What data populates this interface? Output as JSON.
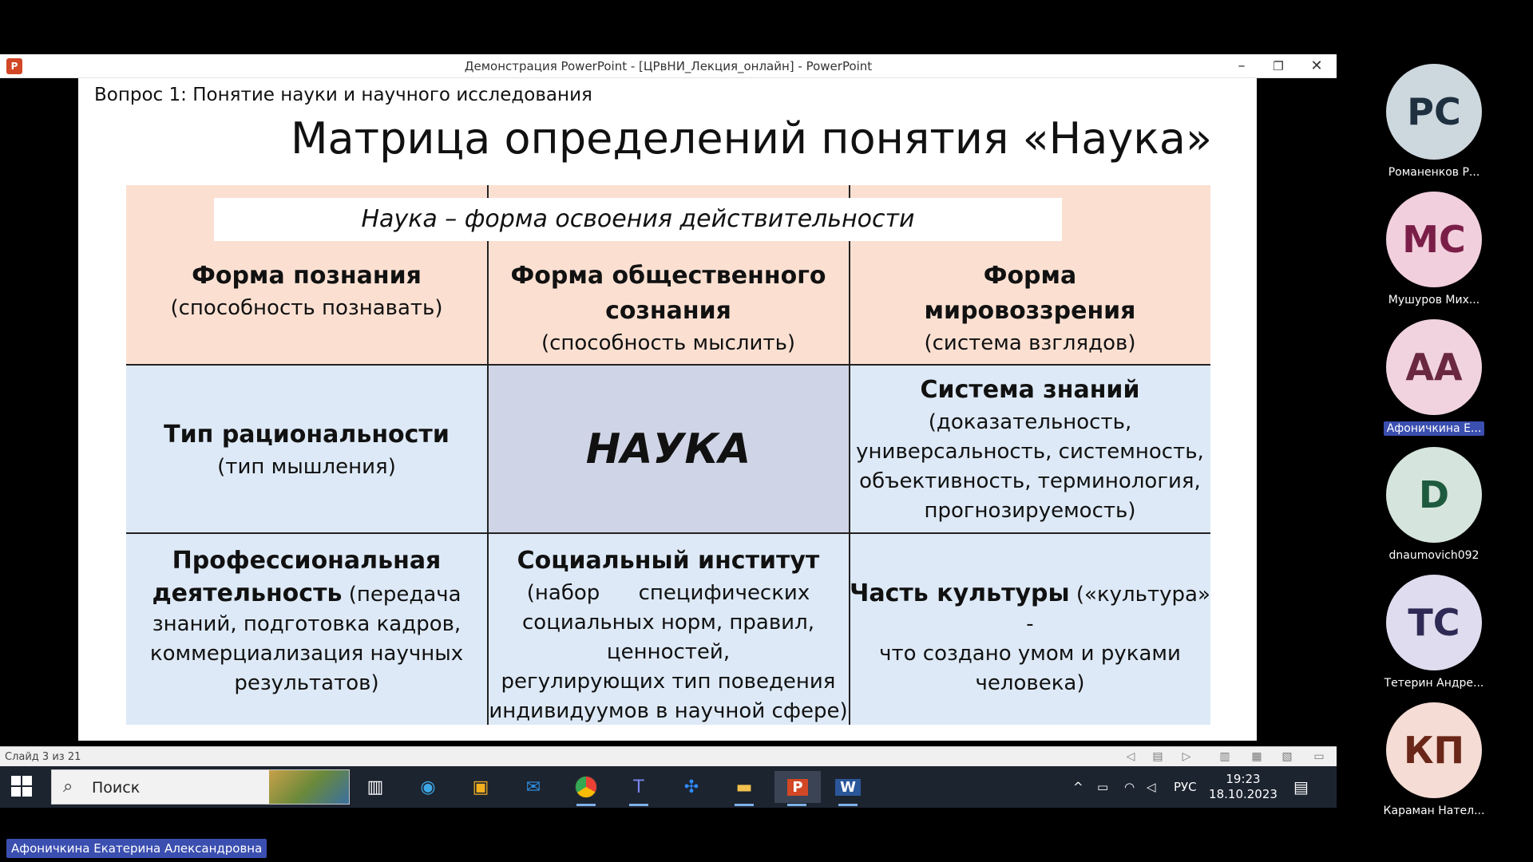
{
  "window": {
    "title": "Демонстрация PowerPoint - [ЦРвНИ_Лекция_онлайн] - PowerPoint",
    "minimize": "–",
    "restore": "❐",
    "close": "✕"
  },
  "slide": {
    "question": "Вопрос 1: Понятие науки и научного исследования",
    "title": "Матрица определений понятия «Наука»",
    "banner": "Наука – форма освоения действительности",
    "cells": {
      "r1c1_bold": "Форма познания",
      "r1c1_text": "(способность познавать)",
      "r1c2_bold1": "Форма общественного",
      "r1c2_bold2": "сознания",
      "r1c2_text": "(способность мыслить)",
      "r1c3_bold1": "Форма",
      "r1c3_bold2": "мировоззрения",
      "r1c3_text": "(система взглядов)",
      "r2c1_bold": "Тип рациональности",
      "r2c1_text": "(тип мышления)",
      "r2c2_big": "НАУКА",
      "r2c3_bold": "Система знаний",
      "r2c3_l1": "(доказательность,",
      "r2c3_l2": "универсальность, системность,",
      "r2c3_l3": "объективность, терминология,",
      "r2c3_l4": "прогнозируемость)",
      "r3c1_bold1": "Профессиональная",
      "r3c1_bold2": "деятельность",
      "r3c1_l1": " (передача",
      "r3c1_l2": "знаний, подготовка кадров,",
      "r3c1_l3": "коммерциализация научных",
      "r3c1_l4": "результатов)",
      "r3c2_bold": "Социальный институт",
      "r3c2_l1": "(набор специфических",
      "r3c2_l2": "социальных норм, правил,",
      "r3c2_l3": "ценностей,",
      "r3c2_l4": "регулирующих тип поведения",
      "r3c2_l5": "индивидуумов в научной сфере)",
      "r3c3_bold": "Часть культуры",
      "r3c3_l1": " («культура» -",
      "r3c3_l2": "что создано умом и руками",
      "r3c3_l3": "человека)"
    }
  },
  "statusbar": {
    "slide_counter": "Слайд 3 из 21"
  },
  "taskbar": {
    "search_placeholder": "Поиск",
    "lang": "РУС",
    "time": "19:23",
    "date": "18.10.2023"
  },
  "participants": [
    {
      "initials": "РС",
      "name": "Романенков Р...",
      "bg": "#cdd7de",
      "fg": "#1f3140"
    },
    {
      "initials": "МС",
      "name": "Мушуров Мих...",
      "bg": "#f2cfdc",
      "fg": "#7a1e48"
    },
    {
      "initials": "АА",
      "name": "Афоничкина Е...",
      "bg": "#f0d3de",
      "fg": "#6a2840"
    },
    {
      "initials": "D",
      "name": "dnaumovich092",
      "bg": "#d5e4dc",
      "fg": "#1e5a3e"
    },
    {
      "initials": "ТС",
      "name": "Тетерин Андре...",
      "bg": "#e0dcef",
      "fg": "#2e2a55"
    },
    {
      "initials": "КП",
      "name": "Караман Нател...",
      "bg": "#f5dcd4",
      "fg": "#6a2618"
    }
  ],
  "presenter": "Афоничкина Екатерина Александровна",
  "colors": {
    "header_bg": "#fbe0d2",
    "body_bg": "#dde9f6",
    "center_bg": "#cfd5e6",
    "highlight": "#3b4fb0"
  }
}
